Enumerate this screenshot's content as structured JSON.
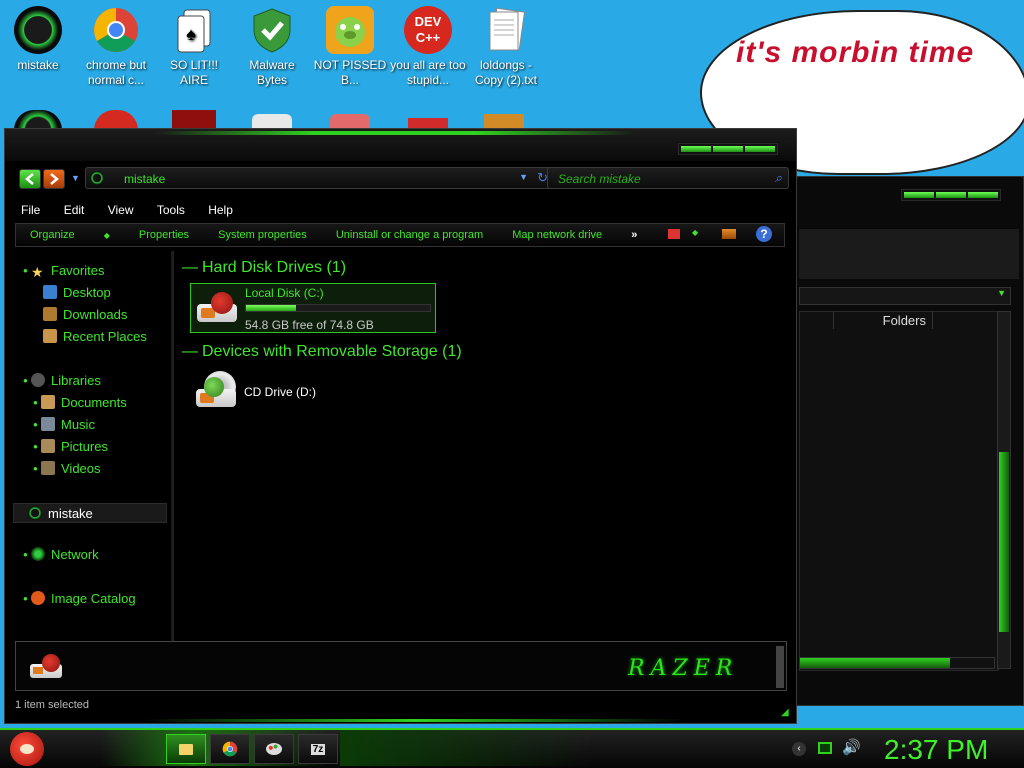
{
  "desktop": {
    "icons": [
      {
        "label": "mistake"
      },
      {
        "label": "chrome but normal c..."
      },
      {
        "label": "SO LIT!!! AIRE"
      },
      {
        "label": "Malware Bytes"
      },
      {
        "label": "NOT PISSED B..."
      },
      {
        "label": "you all are too stupid..."
      },
      {
        "label": "loldongs - Copy (2).txt"
      }
    ],
    "devcpp_text": "DEV C++",
    "bubble_text": "it's morbin time"
  },
  "explorer": {
    "address_path": "mistake",
    "search_placeholder": "Search mistake",
    "menu": [
      "File",
      "Edit",
      "View",
      "Tools",
      "Help"
    ],
    "commands": [
      "Organize",
      "Properties",
      "System properties",
      "Uninstall or change a program",
      "Map network drive"
    ],
    "more_chevron": "»",
    "help_glyph": "?",
    "sidebar": {
      "favorites": "Favorites",
      "desktop": "Desktop",
      "downloads": "Downloads",
      "recent": "Recent Places",
      "libraries": "Libraries",
      "documents": "Documents",
      "music": "Music",
      "pictures": "Pictures",
      "videos": "Videos",
      "mistake": "mistake",
      "network": "Network",
      "image_catalog": "Image Catalog"
    },
    "groups": {
      "hard_disk": "Hard Disk Drives (1)",
      "removable": "Devices with Removable Storage (1)"
    },
    "drives": {
      "c_label": "Local Disk (C:)",
      "c_free": "54.8 GB free of 74.8 GB",
      "c_used_fraction": 0.27,
      "d_label": "CD Drive (D:)"
    },
    "status": "1 item selected",
    "brand": "RAZER"
  },
  "background_window": {
    "column_header": "Folders"
  },
  "taskbar": {
    "clock": "2:37 PM"
  },
  "colors": {
    "accent_green": "#41e52e",
    "desktop_blue": "#29aae6",
    "bubble_red": "#c8102e"
  }
}
